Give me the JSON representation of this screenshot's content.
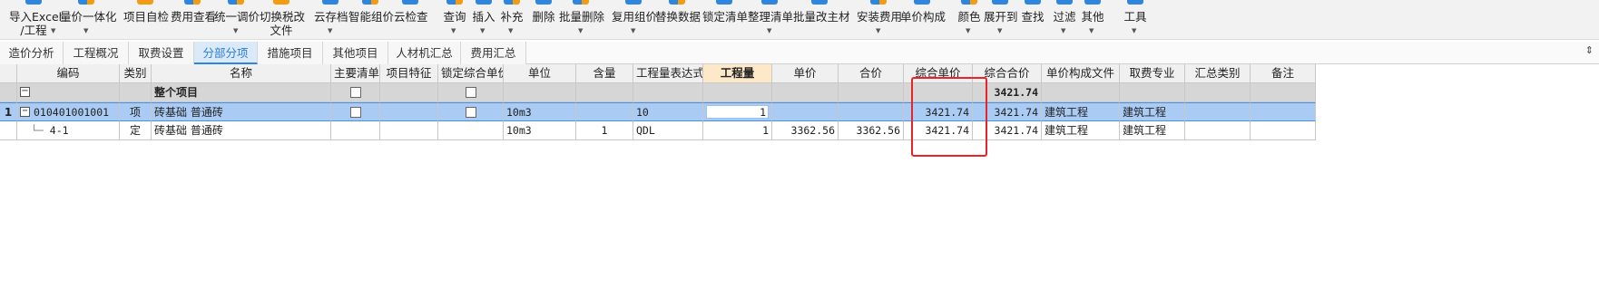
{
  "toolbar": {
    "items": [
      {
        "label": "导入Excel\n/工程",
        "icon": "import-excel-icon",
        "caret": true
      },
      {
        "label": "量价一体化",
        "icon": "qty-price-icon",
        "caret": true
      },
      {
        "label": "项目自检",
        "icon": "self-check-icon",
        "caret": false
      },
      {
        "label": "费用查看",
        "icon": "fee-view-icon",
        "caret": false
      },
      {
        "label": "统一调价",
        "icon": "adjust-price-icon",
        "caret": true
      },
      {
        "label": "切换税改\n文件",
        "icon": "switch-tax-icon",
        "caret": false
      },
      {
        "label": "云存档",
        "icon": "cloud-save-icon",
        "caret": true
      },
      {
        "label": "智能组价",
        "icon": "smart-price-icon",
        "caret": false
      },
      {
        "label": "云检查",
        "icon": "cloud-check-icon",
        "caret": false
      },
      {
        "label": "查询",
        "icon": "search-icon",
        "caret": true
      },
      {
        "label": "插入",
        "icon": "insert-icon",
        "caret": true
      },
      {
        "label": "补充",
        "icon": "supplement-icon",
        "caret": true
      },
      {
        "label": "删除",
        "icon": "delete-icon",
        "caret": false
      },
      {
        "label": "批量删除",
        "icon": "batch-delete-icon",
        "caret": true
      },
      {
        "label": "复用组价",
        "icon": "reuse-price-icon",
        "caret": true
      },
      {
        "label": "替换数据",
        "icon": "replace-data-icon",
        "caret": false
      },
      {
        "label": "锁定清单",
        "icon": "lock-list-icon",
        "caret": false
      },
      {
        "label": "整理清单",
        "icon": "organize-list-icon",
        "caret": true
      },
      {
        "label": "批量改主材",
        "icon": "batch-material-icon",
        "caret": false
      },
      {
        "label": "安装费用",
        "icon": "install-fee-icon",
        "caret": true
      },
      {
        "label": "单价构成",
        "icon": "unit-price-icon",
        "caret": false
      },
      {
        "label": "颜色",
        "icon": "color-icon",
        "caret": true
      },
      {
        "label": "展开到",
        "icon": "expand-icon",
        "caret": true
      },
      {
        "label": "查找",
        "icon": "find-icon",
        "caret": false
      },
      {
        "label": "过滤",
        "icon": "filter-icon",
        "caret": true
      },
      {
        "label": "其他",
        "icon": "other-icon",
        "caret": true
      },
      {
        "label": "工具",
        "icon": "tools-icon",
        "caret": true
      }
    ]
  },
  "tabs": [
    {
      "label": "造价分析",
      "active": false
    },
    {
      "label": "工程概况",
      "active": false
    },
    {
      "label": "取费设置",
      "active": false
    },
    {
      "label": "分部分项",
      "active": true
    },
    {
      "label": "措施项目",
      "active": false
    },
    {
      "label": "其他项目",
      "active": false
    },
    {
      "label": "人材机汇总",
      "active": false
    },
    {
      "label": "费用汇总",
      "active": false
    }
  ],
  "table": {
    "headers": [
      "",
      "编码",
      "类别",
      "名称",
      "主要清单",
      "项目特征",
      "锁定综合单价",
      "单位",
      "含量",
      "工程量表达式",
      "工程量",
      "单价",
      "合价",
      "综合单价",
      "综合合价",
      "单价构成文件",
      "取费专业",
      "汇总类别",
      "备注"
    ],
    "rows": {
      "total": {
        "name": "整个项目",
        "total_price": "3421.74"
      },
      "item": {
        "rowno": "1",
        "code": "010401001001",
        "type": "项",
        "name": "砖基础 普通砖",
        "unit": "10m3",
        "expr": "10",
        "qty": "1",
        "comp_unit_price": "3421.74",
        "comp_total": "3421.74",
        "price_file": "建筑工程",
        "fee_major": "建筑工程"
      },
      "quota": {
        "code": "4-1",
        "type": "定",
        "name": "砖基础 普通砖",
        "unit": "10m3",
        "content": "1",
        "expr": "QDL",
        "qty": "1",
        "unit_price": "3362.56",
        "total_price": "3362.56",
        "comp_unit_price": "3421.74",
        "comp_total": "3421.74",
        "price_file": "建筑工程",
        "fee_major": "建筑工程"
      }
    }
  },
  "colors": {
    "accent": "#2e86de",
    "selected_row": "#a9cbf4",
    "highlight_box": "#e8232a"
  }
}
